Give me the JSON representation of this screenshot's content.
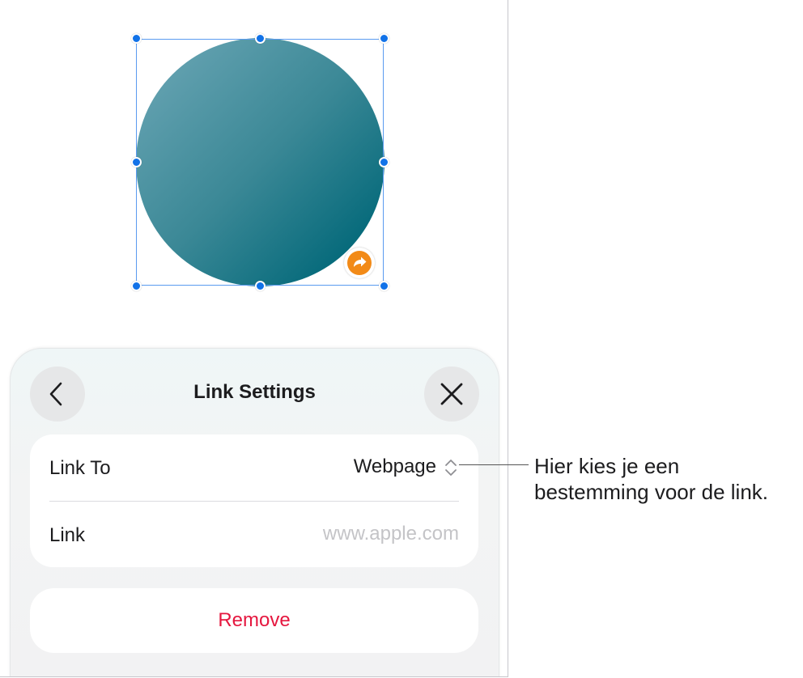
{
  "sheet": {
    "title": "Link Settings",
    "back_icon": "chevron-left-icon",
    "close_icon": "close-icon"
  },
  "settings": {
    "link_to_label": "Link To",
    "link_to_value": "Webpage",
    "link_to_icon": "chevron-up-down-icon",
    "link_label": "Link",
    "link_placeholder": "www.apple.com",
    "link_value": ""
  },
  "actions": {
    "remove_label": "Remove"
  },
  "callout": {
    "text_line1": "Hier kies je een",
    "text_line2": "bestemming voor de link."
  },
  "canvas": {
    "shape_icon": "link-badge-icon"
  },
  "colors": {
    "accent": "#1172e8",
    "destructive": "#e5173f",
    "link_badge": "#f28a17",
    "shape_gradient_start": "#6ea8b7",
    "shape_gradient_end": "#006778"
  }
}
